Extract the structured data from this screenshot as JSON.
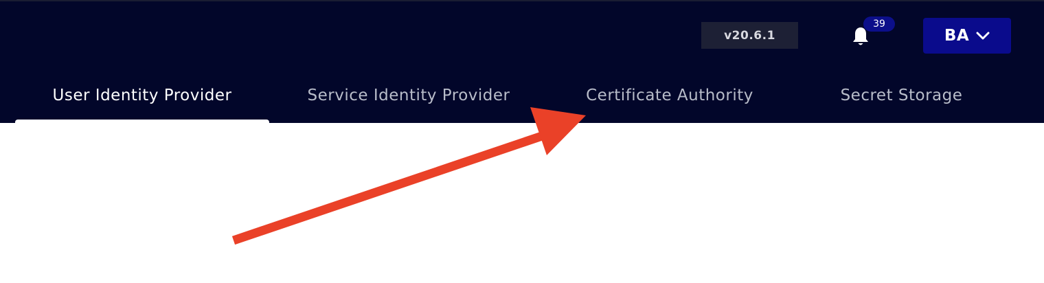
{
  "header": {
    "version": "v20.6.1",
    "notifications": {
      "count": "39",
      "icon": "bell-icon"
    },
    "user": {
      "initials": "BA",
      "icon": "chevron-down-icon"
    }
  },
  "tabs": [
    {
      "label": "User Identity Provider",
      "active": true
    },
    {
      "label": "Service Identity Provider",
      "active": false
    },
    {
      "label": "Certificate Authority",
      "active": false
    },
    {
      "label": "Secret Storage",
      "active": false
    }
  ],
  "annotation": {
    "icon": "annotation-arrow",
    "color": "#ea4128"
  },
  "colors": {
    "header_bg": "#02062a",
    "accent": "#0a0b8c",
    "badge_bg": "#0c0f8a",
    "version_bg": "#1d2035"
  }
}
